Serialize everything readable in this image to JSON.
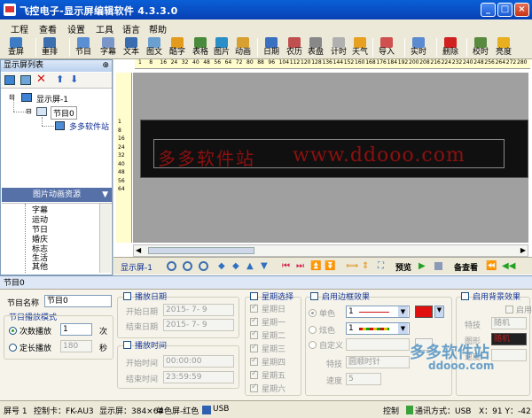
{
  "window": {
    "title": "飞控电子-显示屏编辑软件 4.3.3.0",
    "min": "_",
    "max": "□",
    "close": "×"
  },
  "menu": [
    "工程",
    "查看",
    "设置",
    "工具",
    "语言",
    "帮助"
  ],
  "toolbar": [
    {
      "label": "查屏",
      "icon": "search-screen-icon",
      "color": "#3d7bc4"
    },
    {
      "label": "重排",
      "icon": "rearrange-icon",
      "color": "#3c6fb0"
    },
    {
      "label": "节目",
      "icon": "program-icon",
      "color": "#5b8fd3"
    },
    {
      "label": "字幕",
      "icon": "subtitle-icon",
      "color": "#7a96c8"
    },
    {
      "label": "文本",
      "icon": "text-icon",
      "color": "#3a6db0"
    },
    {
      "label": "图文",
      "icon": "image-text-icon",
      "color": "#6a9fd0"
    },
    {
      "label": "酷字",
      "icon": "cool-text-icon",
      "color": "#e39b1d"
    },
    {
      "label": "表格",
      "icon": "table-icon",
      "color": "#4a8a3c"
    },
    {
      "label": "图片",
      "icon": "picture-icon",
      "color": "#2a8fc8"
    },
    {
      "label": "动画",
      "icon": "animation-icon",
      "color": "#d8a030"
    },
    {
      "label": "日期",
      "icon": "date-icon",
      "color": "#3a70c0"
    },
    {
      "label": "农历",
      "icon": "lunar-icon",
      "color": "#c05050"
    },
    {
      "label": "表盘",
      "icon": "dial-icon",
      "color": "#888888"
    },
    {
      "label": "计时",
      "icon": "timer-icon",
      "color": "#b0b0b0"
    },
    {
      "label": "天气",
      "icon": "weather-icon",
      "color": "#e8a020"
    },
    {
      "label": "导入",
      "icon": "import-icon",
      "color": "#d05050"
    },
    {
      "label": "实时",
      "icon": "realtime-icon",
      "color": "#5a8ad0"
    },
    {
      "label": "删除",
      "icon": "delete-icon",
      "color": "#d02020"
    },
    {
      "label": "校时",
      "icon": "sync-time-icon",
      "color": "#5a8a40"
    },
    {
      "label": "亮度",
      "icon": "brightness-icon",
      "color": "#e8b020"
    }
  ],
  "left_panel": {
    "title": "显示屏列表",
    "pin": "⊕",
    "tree": {
      "screen": "显示屏-1",
      "program": "节目0",
      "item": "多多软件站"
    },
    "resource_title": "图片动画资源",
    "resources": [
      "字幕",
      "运动",
      "节日",
      "婚庆",
      "标志",
      "生活",
      "其他"
    ]
  },
  "ruler_top": [
    "1",
    "8",
    "16",
    "24",
    "32",
    "40",
    "48",
    "56",
    "64",
    "72",
    "80",
    "88",
    "96",
    "104",
    "112",
    "120",
    "128",
    "136",
    "144",
    "152",
    "160",
    "168",
    "176",
    "184",
    "192",
    "200",
    "208",
    "216",
    "224",
    "232",
    "240",
    "248",
    "256",
    "264",
    "272",
    "280"
  ],
  "ruler_left": [
    "1",
    "8",
    "16",
    "24",
    "32",
    "40",
    "48",
    "56",
    "64"
  ],
  "led": {
    "text_cn": "多多软件站",
    "text_en": "www.ddooo.com",
    "text_color": "#8b1010"
  },
  "nav": {
    "screen_label": "显示屏-1",
    "preview": "预览",
    "view": "备查看"
  },
  "props": {
    "header": "节目0",
    "program_name_label": "节目名称",
    "program_name": "节目0",
    "mode_title": "节目播放模式",
    "count_label": "次数播放",
    "count_value": "1",
    "count_unit": "次",
    "fixed_label": "定长播放",
    "fixed_value": "180",
    "fixed_unit": "秒",
    "date_title": "播放日期",
    "start_date_label": "开始日期",
    "start_date": "2015- 7- 9",
    "end_date_label": "结束日期",
    "end_date": "2015- 7- 9",
    "time_title": "播放时间",
    "start_time_label": "开始时间",
    "start_time": "00:00:00",
    "end_time_label": "结束时间",
    "end_time": "23:59:59",
    "week_title": "星期选择",
    "weekdays": [
      "星期日",
      "星期一",
      "星期二",
      "星期三",
      "星期四",
      "星期五",
      "星期六"
    ],
    "border_title": "启用边框效果",
    "border_mono": "单色",
    "border_color": "炫色",
    "border_custom": "自定义",
    "border_width1": "1",
    "border_width2": "1",
    "effect_label": "特技",
    "effect_value": "圆顺时针",
    "speed_label": "速度",
    "speed_value": "5",
    "bg_title": "启用背景效果",
    "bg_effect_label": "特技",
    "bg_effect_value": "随机",
    "bg_enable": "启用",
    "bg_pattern_label": "图形",
    "bg_pattern_value": "随机",
    "bg_speed_label": "速度",
    "swatch_red": "#e01010"
  },
  "status": {
    "screen_no": "屏号 1",
    "card": "控制卡：FK-AU3",
    "display": "显示屏：384×64",
    "color_mode": "单色屏-红色",
    "usb": "USB",
    "ctrl": "控制",
    "comm": "通讯方式：USB",
    "coord": "X：91 Y：-42"
  },
  "watermark": {
    "line1": "多多软件站",
    "line2": "ddooo.com"
  }
}
